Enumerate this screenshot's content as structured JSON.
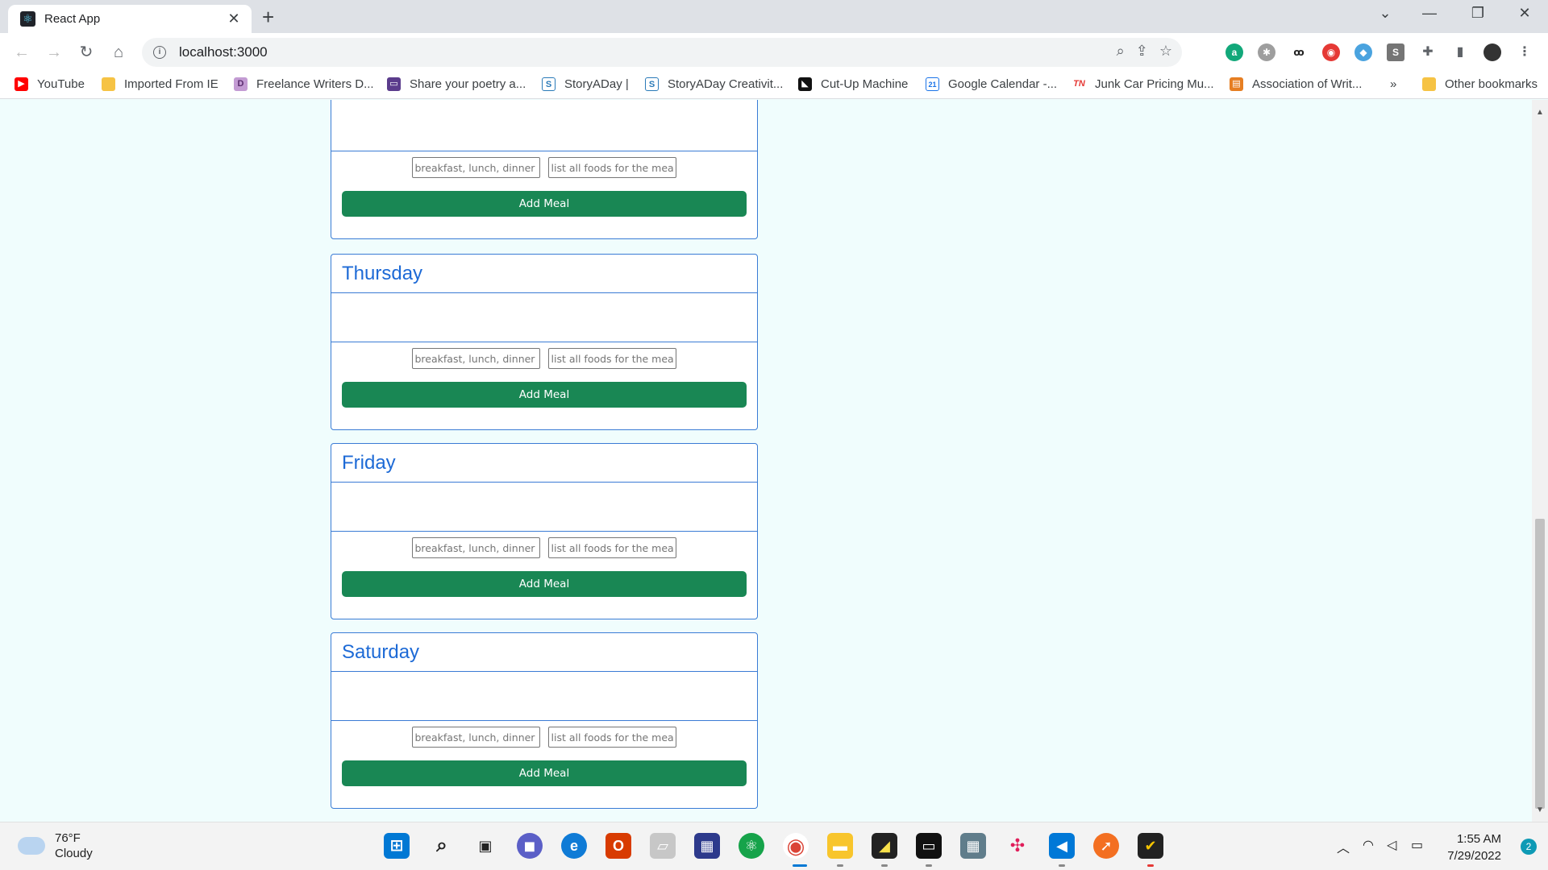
{
  "browser": {
    "tab_title": "React App",
    "url": "localhost:3000",
    "new_tab_glyph": "+",
    "close_glyph": "✕"
  },
  "bookmarks": [
    {
      "label": "YouTube",
      "icon": "youtube-icon",
      "color": "#ff0000"
    },
    {
      "label": "Imported From IE",
      "icon": "folder-icon",
      "color": "#f6c344"
    },
    {
      "label": "Freelance Writers D...",
      "icon": "d-icon",
      "color": "#9b59b6"
    },
    {
      "label": "Share your poetry a...",
      "icon": "poetry-icon",
      "color": "#5b3c8c"
    },
    {
      "label": "StoryADay |",
      "icon": "storyaday-icon",
      "color": "#2a7ab8"
    },
    {
      "label": "StoryADay Creativit...",
      "icon": "storyaday-icon",
      "color": "#2a7ab8"
    },
    {
      "label": "Cut-Up Machine",
      "icon": "cutup-icon",
      "color": "#111111"
    },
    {
      "label": "Google Calendar -...",
      "icon": "calendar-icon",
      "color": "#1a73e8"
    },
    {
      "label": "Junk Car Pricing Mu...",
      "icon": "tn-icon",
      "color": "#e53935"
    },
    {
      "label": "Association of Writ...",
      "icon": "awp-icon",
      "color": "#e67e22"
    },
    {
      "label": "Other bookmarks",
      "icon": "folder-icon",
      "color": "#f6c344"
    }
  ],
  "bookmark_overflow": "»",
  "days": [
    {
      "name": "",
      "placeholder_meal": "breakfast, lunch, dinner",
      "placeholder_foods": "list all foods for the meal",
      "button": "Add Meal"
    },
    {
      "name": "Thursday",
      "placeholder_meal": "breakfast, lunch, dinner",
      "placeholder_foods": "list all foods for the meal",
      "button": "Add Meal"
    },
    {
      "name": "Friday",
      "placeholder_meal": "breakfast, lunch, dinner",
      "placeholder_foods": "list all foods for the meal",
      "button": "Add Meal"
    },
    {
      "name": "Saturday",
      "placeholder_meal": "breakfast, lunch, dinner",
      "placeholder_foods": "list all foods for the meal",
      "button": "Add Meal"
    }
  ],
  "taskbar": {
    "weather_temp": "76°F",
    "weather_desc": "Cloudy",
    "time": "1:55 AM",
    "date": "7/29/2022",
    "notifications": "2"
  },
  "colors": {
    "accent_blue": "#1d6ad6",
    "button_green": "#198754",
    "page_bg": "#f0fdfd"
  }
}
